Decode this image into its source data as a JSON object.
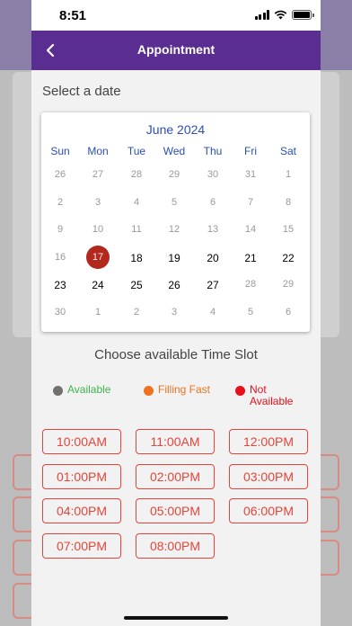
{
  "status_bar": {
    "time": "8:51"
  },
  "header": {
    "title": "Appointment",
    "back_icon": "chevron-left-icon"
  },
  "select_date_label": "Select a date",
  "calendar": {
    "month": "June 2024",
    "weekdays": [
      "Sun",
      "Mon",
      "Tue",
      "Wed",
      "Thu",
      "Fri",
      "Sat"
    ],
    "weeks": [
      [
        {
          "d": "26",
          "s": "muted"
        },
        {
          "d": "27",
          "s": "muted"
        },
        {
          "d": "28",
          "s": "muted"
        },
        {
          "d": "29",
          "s": "muted"
        },
        {
          "d": "30",
          "s": "muted"
        },
        {
          "d": "31",
          "s": "muted"
        },
        {
          "d": "1",
          "s": "muted"
        }
      ],
      [
        {
          "d": "2",
          "s": "muted"
        },
        {
          "d": "3",
          "s": "muted"
        },
        {
          "d": "4",
          "s": "muted"
        },
        {
          "d": "5",
          "s": "muted"
        },
        {
          "d": "6",
          "s": "muted"
        },
        {
          "d": "7",
          "s": "muted"
        },
        {
          "d": "8",
          "s": "muted"
        }
      ],
      [
        {
          "d": "9",
          "s": "muted"
        },
        {
          "d": "10",
          "s": "muted"
        },
        {
          "d": "11",
          "s": "muted"
        },
        {
          "d": "12",
          "s": "muted"
        },
        {
          "d": "13",
          "s": "muted"
        },
        {
          "d": "14",
          "s": "muted"
        },
        {
          "d": "15",
          "s": "muted"
        }
      ],
      [
        {
          "d": "16",
          "s": "muted"
        },
        {
          "d": "17",
          "s": "selected"
        },
        {
          "d": "18",
          "s": "active"
        },
        {
          "d": "19",
          "s": "active"
        },
        {
          "d": "20",
          "s": "active"
        },
        {
          "d": "21",
          "s": "active"
        },
        {
          "d": "22",
          "s": "active"
        }
      ],
      [
        {
          "d": "23",
          "s": "active"
        },
        {
          "d": "24",
          "s": "active"
        },
        {
          "d": "25",
          "s": "active"
        },
        {
          "d": "26",
          "s": "active"
        },
        {
          "d": "27",
          "s": "active"
        },
        {
          "d": "28",
          "s": "muted"
        },
        {
          "d": "29",
          "s": "muted"
        }
      ],
      [
        {
          "d": "30",
          "s": "muted"
        },
        {
          "d": "1",
          "s": "muted"
        },
        {
          "d": "2",
          "s": "muted"
        },
        {
          "d": "3",
          "s": "muted"
        },
        {
          "d": "4",
          "s": "muted"
        },
        {
          "d": "5",
          "s": "muted"
        },
        {
          "d": "6",
          "s": "muted"
        }
      ]
    ]
  },
  "time_slot_heading": "Choose available Time Slot",
  "legend": [
    {
      "label": "Available",
      "color": "#707070",
      "text_color": "#3cb54a"
    },
    {
      "label": "Filling Fast",
      "color": "#f0711e",
      "text_color": "#f0711e"
    },
    {
      "label": "Not\nAvailable",
      "color": "#e8101c",
      "text_color": "#e8101c"
    }
  ],
  "time_slots": [
    "10:00AM",
    "11:00AM",
    "12:00PM",
    "01:00PM",
    "02:00PM",
    "03:00PM",
    "04:00PM",
    "05:00PM",
    "06:00PM",
    "07:00PM",
    "08:00PM"
  ],
  "colors": {
    "accent": "#5a2d91",
    "calendar_blue": "#2a4fb5",
    "slot_red": "#e4453a",
    "selected_day": "#b3281c"
  }
}
